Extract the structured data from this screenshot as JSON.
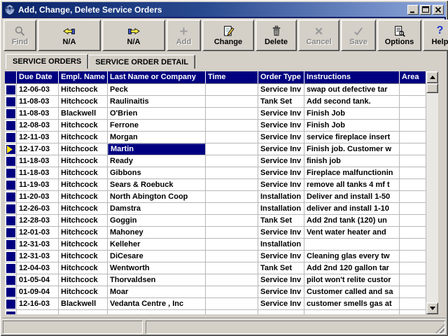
{
  "window": {
    "title": "Add, Change, Delete Service Orders",
    "controls": {
      "minimize": "minimize",
      "maximize": "maximize",
      "close": "close"
    }
  },
  "toolbar": {
    "buttons": [
      {
        "label": "Find",
        "icon": "magnifier-icon",
        "enabled": false
      },
      {
        "label": "N/A",
        "icon": "hand-left-icon",
        "enabled": true
      },
      {
        "label": "N/A",
        "icon": "hand-right-icon",
        "enabled": true
      },
      {
        "label": "Add",
        "icon": "plus-icon",
        "enabled": false
      },
      {
        "label": "Change",
        "icon": "edit-document-icon",
        "enabled": true
      },
      {
        "label": "Delete",
        "icon": "trash-icon",
        "enabled": true
      },
      {
        "label": "Cancel",
        "icon": "x-icon",
        "enabled": false
      },
      {
        "label": "Save",
        "icon": "check-icon",
        "enabled": false
      },
      {
        "label": "Options",
        "icon": "options-list-icon",
        "enabled": true
      },
      {
        "label": "Help",
        "icon": "question-icon",
        "enabled": true
      }
    ]
  },
  "tabs": [
    {
      "label": "SERVICE ORDERS",
      "active": true
    },
    {
      "label": "SERVICE ORDER DETAIL",
      "active": false
    }
  ],
  "table": {
    "columns": [
      "Due Date",
      "Empl. Name",
      "Last Name or Company",
      "Time",
      "Order Type",
      "Instructions",
      "Area"
    ],
    "selected": {
      "row_index": 5,
      "column_index": 2
    },
    "rows": [
      {
        "cells": [
          "12-06-03",
          "Hitchcock",
          "Peck",
          "",
          "Service Inv",
          "swap out defective tar",
          ""
        ]
      },
      {
        "cells": [
          "11-08-03",
          "Hitchcock",
          "Raulinaitis",
          "",
          "Tank Set",
          "Add second tank.",
          ""
        ]
      },
      {
        "cells": [
          "11-08-03",
          "Blackwell",
          "O'Brien",
          "",
          "Service Inv",
          "Finish Job",
          ""
        ]
      },
      {
        "cells": [
          "12-08-03",
          "Hitchcock",
          "Ferrone",
          "",
          "Service Inv",
          "Finish Job",
          ""
        ]
      },
      {
        "cells": [
          "12-11-03",
          "Hitchcock",
          "Morgan",
          "",
          "Service Inv",
          "service fireplace insert",
          ""
        ]
      },
      {
        "cells": [
          "12-17-03",
          "Hitchcock",
          "Martin",
          "",
          "Service Inv",
          "Finish job. Customer w",
          ""
        ],
        "selected": true
      },
      {
        "cells": [
          "11-18-03",
          "Hitchcock",
          "Ready",
          "",
          "Service Inv",
          "finish job",
          ""
        ]
      },
      {
        "cells": [
          "11-18-03",
          "Hitchcock",
          "Gibbons",
          "",
          "Service Inv",
          "Fireplace malfunctionin",
          ""
        ]
      },
      {
        "cells": [
          "11-19-03",
          "Hitchcock",
          "Sears & Roebuck",
          "",
          "Service Inv",
          "remove all tanks 4 mf t",
          ""
        ]
      },
      {
        "cells": [
          "11-20-03",
          "Hitchcock",
          "North Abington Coop",
          "",
          "Installation",
          "Deliver and install 1-50",
          ""
        ]
      },
      {
        "cells": [
          "12-26-03",
          "Hitchcock",
          "Damstra",
          "",
          "Installation",
          "deliver and install 1-10",
          ""
        ]
      },
      {
        "cells": [
          "12-28-03",
          "Hitchcock",
          "Goggin",
          "",
          "Tank Set",
          "Add 2nd tank (120) un",
          ""
        ]
      },
      {
        "cells": [
          "12-01-03",
          "Hitchcock",
          "Mahoney",
          "",
          "Service Inv",
          "Vent water heater and",
          ""
        ]
      },
      {
        "cells": [
          "12-31-03",
          "Hitchcock",
          "Kelleher",
          "",
          "Installation",
          "",
          ""
        ]
      },
      {
        "cells": [
          "12-31-03",
          "Hitchcock",
          "DiCesare",
          "",
          "Service Inv",
          "Cleaning glas every tw",
          ""
        ]
      },
      {
        "cells": [
          "12-04-03",
          "Hitchcock",
          "Wentworth",
          "",
          "Tank Set",
          "Add 2nd 120 gallon tar",
          ""
        ]
      },
      {
        "cells": [
          "01-05-04",
          "Hitchcock",
          "Thorvaldsen",
          "",
          "Service Inv",
          "pilot won't relite custor",
          ""
        ]
      },
      {
        "cells": [
          "01-09-04",
          "Hitchcock",
          "Moar",
          "",
          "Service Inv",
          "Customer called and sa",
          ""
        ]
      },
      {
        "cells": [
          "12-16-03",
          "Blackwell",
          "Vedanta Centre , Inc",
          "",
          "Service Inv",
          "customer smells gas at",
          ""
        ]
      },
      {
        "cells": [
          "",
          "",
          "",
          "",
          "",
          "",
          ""
        ],
        "partial": true
      }
    ]
  },
  "status_bar": {
    "panels": [
      "",
      ""
    ]
  },
  "colors": {
    "window_gray": "#d4d0c8",
    "titlebar_start": "#0a246a",
    "titlebar_end": "#8fa8dc",
    "header_navy": "#000080",
    "selection_bg": "#000080",
    "selection_fg": "#ffffff",
    "row_marker_navy": "#000080",
    "selected_marker_yellow": "#ffe400"
  }
}
